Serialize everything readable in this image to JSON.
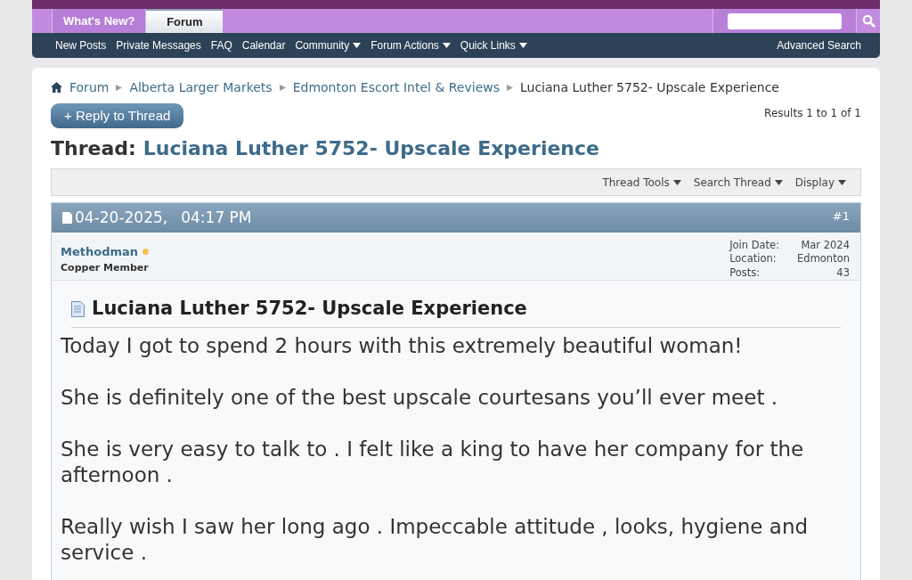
{
  "tabs": [
    {
      "label": "What's New?",
      "selected": false
    },
    {
      "label": "Forum",
      "selected": true
    }
  ],
  "nav": [
    {
      "label": "New Posts",
      "dropdown": false
    },
    {
      "label": "Private Messages",
      "dropdown": false
    },
    {
      "label": "FAQ",
      "dropdown": false
    },
    {
      "label": "Calendar",
      "dropdown": false
    },
    {
      "label": "Community",
      "dropdown": true
    },
    {
      "label": "Forum Actions",
      "dropdown": true
    },
    {
      "label": "Quick Links",
      "dropdown": true
    }
  ],
  "advanced_search": "Advanced Search",
  "breadcrumb": [
    "Forum",
    "Alberta Larger Markets",
    "Edmonton Escort Intel & Reviews",
    "Luciana Luther 5752- Upscale Experience"
  ],
  "reply_button": "+ Reply to Thread",
  "results": "Results 1 to 1 of 1",
  "thread": {
    "label": "Thread:",
    "title": "Luciana Luther 5752- Upscale Experience"
  },
  "toolbar": [
    "Thread Tools",
    "Search Thread",
    "Display"
  ],
  "post": {
    "date": "04-20-2025,",
    "time": "04:17 PM",
    "number": "#1",
    "author": {
      "name": "Methodman",
      "online": true,
      "rank": "Copper Member"
    },
    "info": [
      {
        "label": "Join Date:",
        "value": "Mar 2024"
      },
      {
        "label": "Location:",
        "value": "Edmonton"
      },
      {
        "label": "Posts:",
        "value": "43"
      }
    ],
    "title": "Luciana Luther 5752- Upscale Experience",
    "paragraphs": [
      "Today I got to spend 2 hours with this extremely beautiful woman!",
      "She is definitely one of the best upscale courtesans you’ll ever meet .",
      "She is very easy to talk to . I felt like a king to have her company for the afternoon .",
      "Really wish I saw her long ago . Impeccable attitude , looks, hygiene and service ."
    ]
  }
}
